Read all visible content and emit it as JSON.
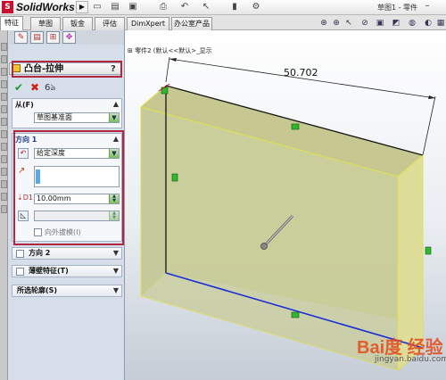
{
  "app": {
    "brand": "SolidWorks",
    "doc_title": "草图1 - 零件"
  },
  "titlebar_icons": [
    "new-icon",
    "open-icon",
    "save-icon",
    "print-icon",
    "undo-icon",
    "select-icon",
    "rebuild-icon",
    "options-icon"
  ],
  "tabs": [
    {
      "label": "特征",
      "active": true
    },
    {
      "label": "草图",
      "active": false
    },
    {
      "label": "钣金",
      "active": false
    },
    {
      "label": "评估",
      "active": false
    },
    {
      "label": "DimXpert",
      "active": false
    },
    {
      "label": "办公室产品",
      "active": false
    }
  ],
  "property_manager": {
    "title": "凸台-拉伸",
    "help": "?",
    "from": {
      "title": "从(F)",
      "chevron": "▲",
      "value": "草图基准面"
    },
    "direction1": {
      "title": "方向 1",
      "chevron": "▲",
      "end_condition": "给定深度",
      "depth": "10.00mm",
      "draft_label": "向外拔模(I)"
    },
    "direction2": {
      "title": "方向 2",
      "chevron": "▼"
    },
    "thin_feature": {
      "title": "薄壁特征(T)",
      "chevron": "▼"
    },
    "selected_contours": {
      "title": "所选轮廓(S)",
      "chevron": "▼"
    }
  },
  "graphics": {
    "tree_text": "零件2 (默认<<默认>_显示",
    "dimension": "50.702",
    "colors": {
      "face_front": "#c9cd98",
      "face_side": "#dede9a",
      "face_top": "#c7c891",
      "sketch_edge": "#151515",
      "bottom_edge": "#1a2dd6",
      "outline": "#e0e050",
      "relation_marker": "#2fb82f"
    }
  },
  "watermark": {
    "brand": "Bai度 经验",
    "url": "jingyan.baidu.com"
  }
}
